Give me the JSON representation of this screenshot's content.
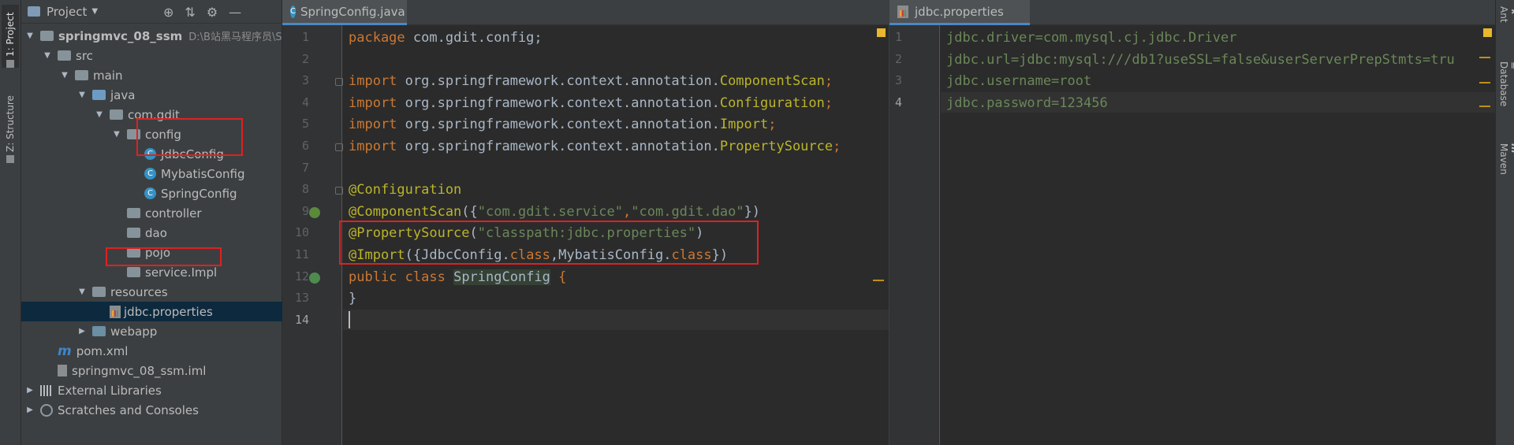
{
  "left_tool_strip": {
    "tabs": [
      {
        "label": "1: Project"
      },
      {
        "label": "Z: Structure"
      }
    ]
  },
  "project_panel": {
    "title": "Project",
    "tree": [
      {
        "label": "springmvc_08_ssm",
        "path": "D:\\B站黑马程序员\\S",
        "depth": 0,
        "expanded": true,
        "icon": "module-folder-icon"
      },
      {
        "label": "src",
        "depth": 1,
        "expanded": true,
        "icon": "folder-icon"
      },
      {
        "label": "main",
        "depth": 2,
        "expanded": true,
        "icon": "folder-icon"
      },
      {
        "label": "java",
        "depth": 3,
        "expanded": true,
        "icon": "source-folder-icon"
      },
      {
        "label": "com.gdit",
        "depth": 4,
        "expanded": true,
        "icon": "package-icon"
      },
      {
        "label": "config",
        "depth": 5,
        "expanded": true,
        "icon": "package-icon"
      },
      {
        "label": "JdbcConfig",
        "depth": 6,
        "icon": "class-icon"
      },
      {
        "label": "MybatisConfig",
        "depth": 6,
        "icon": "class-icon"
      },
      {
        "label": "SpringConfig",
        "depth": 6,
        "icon": "class-icon"
      },
      {
        "label": "controller",
        "depth": 5,
        "icon": "package-icon"
      },
      {
        "label": "dao",
        "depth": 5,
        "icon": "package-icon"
      },
      {
        "label": "pojo",
        "depth": 5,
        "icon": "package-icon"
      },
      {
        "label": "service.Impl",
        "depth": 5,
        "icon": "package-icon"
      },
      {
        "label": "resources",
        "depth": 3,
        "expanded": true,
        "icon": "resources-folder-icon"
      },
      {
        "label": "jdbc.properties",
        "depth": 4,
        "icon": "properties-file-icon",
        "selected": true
      },
      {
        "label": "webapp",
        "depth": 3,
        "expanded": false,
        "icon": "web-folder-icon"
      },
      {
        "label": "pom.xml",
        "depth": 1,
        "icon": "maven-icon"
      },
      {
        "label": "springmvc_08_ssm.iml",
        "depth": 1,
        "icon": "iml-file-icon"
      },
      {
        "label": "External Libraries",
        "depth": 0,
        "expanded": false,
        "icon": "libraries-icon"
      },
      {
        "label": "Scratches and Consoles",
        "depth": 0,
        "expanded": false,
        "icon": "scratches-icon"
      }
    ]
  },
  "editor_left": {
    "tab_label": "SpringConfig.java",
    "line_numbers": [
      "1",
      "2",
      "3",
      "4",
      "5",
      "6",
      "7",
      "8",
      "9",
      "10",
      "11",
      "12",
      "13",
      "14"
    ],
    "current_line": "14",
    "lines": [
      {
        "kw": "package",
        "rest": " com.gdit.config;"
      },
      {},
      {
        "kw": "import",
        "rest": " org.springframework.context.annotation.",
        "cls": "ComponentScan",
        "end": ";"
      },
      {
        "kw": "import",
        "rest": " org.springframework.context.annotation.",
        "cls": "Configuration",
        "end": ";"
      },
      {
        "kw": "import",
        "rest": " org.springframework.context.annotation.",
        "cls": "Import",
        "end": ";"
      },
      {
        "kw": "import",
        "rest": " org.springframework.context.annotation.",
        "cls": "PropertySource",
        "end": ";"
      },
      {},
      {
        "ann": "@Configuration"
      },
      {
        "ann": "@ComponentScan",
        "open": "({",
        "s1": "\"com.gdit.service\"",
        "comma": ",",
        "s2": "\"com.gdit.dao\"",
        "close": "})"
      },
      {
        "ann": "@PropertySource",
        "open": "(",
        "s1": "\"classpath:jdbc.properties\"",
        "close": ")"
      },
      {
        "ann": "@Import",
        "open": "({JdbcConfig.",
        "k1": "class",
        "mid": ",MybatisConfig.",
        "k2": "class",
        "close": "})"
      },
      {
        "kw": "public class",
        "space": " ",
        "name": "SpringConfig",
        "end": " {"
      },
      {
        "text": "}"
      },
      {}
    ]
  },
  "editor_right": {
    "tab_label": "jdbc.properties",
    "line_numbers": [
      "1",
      "2",
      "3",
      "4"
    ],
    "current_line": "4",
    "lines": [
      "jdbc.driver=com.mysql.cj.jdbc.Driver",
      "jdbc.url=jdbc:mysql:///db1?useSSL=false&userServerPrepStmts=tru",
      "jdbc.username=root",
      "jdbc.password=123456"
    ]
  },
  "right_tool_strip": {
    "tabs": [
      {
        "label": "Ant"
      },
      {
        "label": "Database"
      },
      {
        "label": "Maven"
      }
    ]
  },
  "colors": {
    "keyword": "#cc7832",
    "annotation": "#bbb529",
    "string": "#6a8759",
    "highlight_box": "#e02020",
    "selection": "#0d293e"
  }
}
